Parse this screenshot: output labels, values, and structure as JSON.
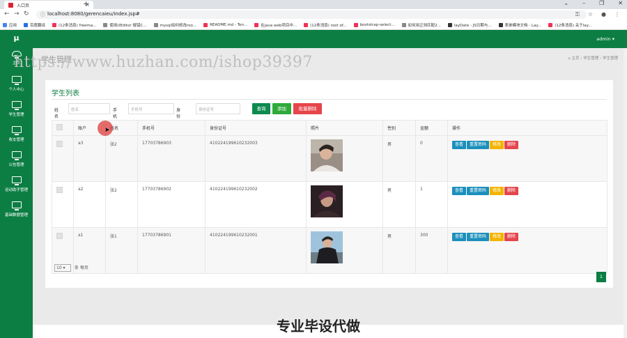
{
  "browser": {
    "tab_title": "入口页",
    "new_tab": "+",
    "url": "localhost:8080/gerencaieu/index.jsp#",
    "window_controls": [
      "⌄",
      "–",
      "❐",
      "✕"
    ],
    "bookmarks": [
      "应用",
      "百度翻译",
      "(12条消息) freema...",
      "使用UEditor 报错C...",
      "mysql如何修改roo...",
      "README.md - Ten...",
      "在java web项目中...",
      "(12条消息) root of...",
      "bootstrap-select...",
      "如何用正则匹配2...",
      "layDate - JS日期与...",
      "表单模块文档 - Lay...",
      "(12条消息) 关于lay..."
    ]
  },
  "app": {
    "logo": "μ",
    "admin": "admin ▾",
    "sidebar": [
      "主页",
      "个人中心",
      "学生管理",
      "收支管理",
      "公告管理",
      "运动助手管理",
      "基础数据管理"
    ],
    "page_title": "学生管理",
    "breadcrumb": [
      "主页",
      "学生管理",
      "学生管理"
    ],
    "watermark": "https://www.huzhan.com/ishop39397",
    "overlay": "专业毕设代做"
  },
  "list": {
    "title": "学生列表",
    "search": {
      "name_label": "姓名",
      "name_placeholder": "姓名",
      "phone_label": "手机号",
      "phone_placeholder": "手机号",
      "id_label": "身份证号",
      "id_placeholder": "身份证号"
    },
    "buttons": {
      "search": "查询",
      "add": "添加",
      "batch_delete": "批量删除"
    },
    "columns": [
      "账户",
      "姓名",
      "手机号",
      "身份证号",
      "照片",
      "性别",
      "金额",
      "操作"
    ],
    "rows": [
      {
        "account": "a3",
        "name": "张2",
        "phone": "17703786903",
        "idcard": "410224199610232003",
        "gender": "男",
        "amount": "0"
      },
      {
        "account": "a2",
        "name": "张2",
        "phone": "17703786902",
        "idcard": "410224199610232002",
        "gender": "男",
        "amount": "1"
      },
      {
        "account": "a1",
        "name": "张1",
        "phone": "17703786901",
        "idcard": "410224199610232001",
        "gender": "男",
        "amount": "300"
      }
    ],
    "actions": {
      "view": "查看",
      "reset": "重置密码",
      "edit": "修改",
      "delete": "删除"
    },
    "page_size": "10",
    "per_page_label": "条 每页",
    "current_page": "1"
  }
}
